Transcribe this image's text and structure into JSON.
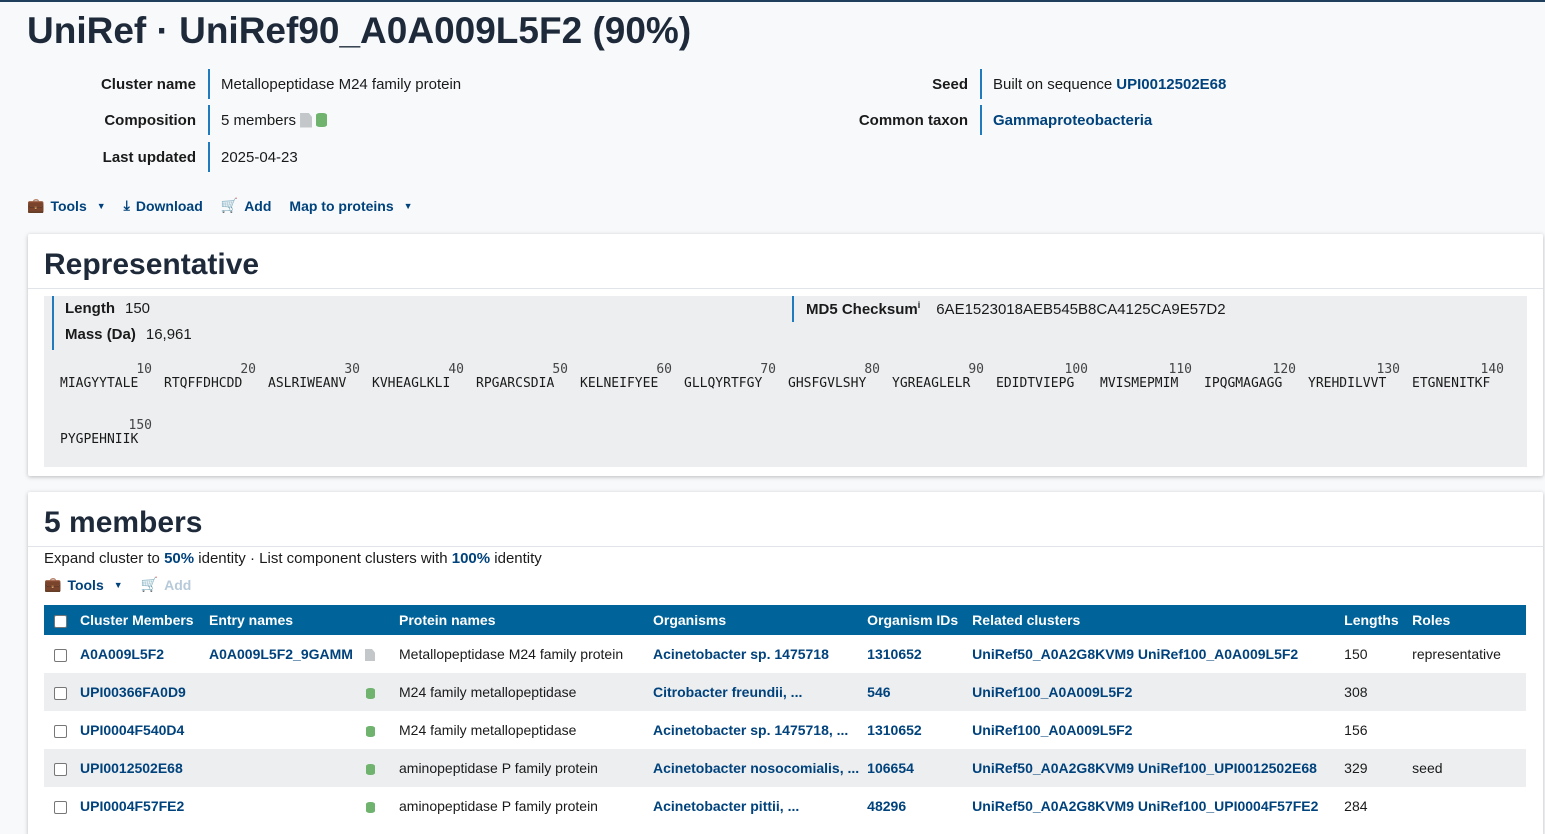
{
  "title": "UniRef · UniRef90_A0A009L5F2 (90%)",
  "info": {
    "cluster_name_label": "Cluster name",
    "cluster_name": "Metallopeptidase M24 family protein",
    "composition_label": "Composition",
    "composition": "5 members",
    "last_updated_label": "Last updated",
    "last_updated": "2025-04-23",
    "seed_label": "Seed",
    "seed_prefix": "Built on sequence",
    "seed_link": "UPI0012502E68",
    "common_taxon_label": "Common taxon",
    "common_taxon": "Gammaproteobacteria"
  },
  "toolbar": {
    "tools": "Tools",
    "download": "Download",
    "add": "Add",
    "map": "Map to proteins"
  },
  "representative": {
    "title": "Representative",
    "length_label": "Length",
    "length": "150",
    "mass_label": "Mass (Da)",
    "mass": "16,961",
    "md5_label": "MD5 Checksum",
    "md5_info": "i",
    "md5": "6AE1523018AEB545B8CA4125CA9E57D2",
    "chunks": [
      {
        "num": "10",
        "seq": "MIAGYYTALE"
      },
      {
        "num": "20",
        "seq": "RTQFFDHCDD"
      },
      {
        "num": "30",
        "seq": "ASLRIWEANV"
      },
      {
        "num": "40",
        "seq": "KVHEAGLKLI"
      },
      {
        "num": "50",
        "seq": "RPGARCSDIA"
      },
      {
        "num": "60",
        "seq": "KELNEIFYEE"
      },
      {
        "num": "70",
        "seq": "GLLQYRTFGY"
      },
      {
        "num": "80",
        "seq": "GHSFGVLSHY"
      },
      {
        "num": "90",
        "seq": "YGREAGLELR"
      },
      {
        "num": "100",
        "seq": "EDIDTVIEPG"
      },
      {
        "num": "110",
        "seq": "MVISMEPMIM"
      },
      {
        "num": "120",
        "seq": "IPQGMAGAGG"
      },
      {
        "num": "130",
        "seq": "YREHDILVVT"
      },
      {
        "num": "140",
        "seq": "ETGNENITKF"
      },
      {
        "num": "150",
        "seq": "PYGPEHNIIK"
      }
    ]
  },
  "members": {
    "title": "5 members",
    "expand_prefix": "Expand cluster to",
    "expand_link": "50%",
    "expand_middle": "identity · List component clusters with",
    "expand_link2": "100%",
    "expand_suffix": "identity",
    "tools": "Tools",
    "add": "Add",
    "columns": [
      "Cluster Members",
      "Entry names",
      "Protein names",
      "Organisms",
      "Organism IDs",
      "Related clusters",
      "Lengths",
      "Roles"
    ],
    "rows": [
      {
        "id": "A0A009L5F2",
        "entry": "A0A009L5F2_9GAMM",
        "icon": "doc",
        "protein": "Metallopeptidase M24 family protein",
        "organism": "Acinetobacter sp. 1475718",
        "orgid": "1310652",
        "related": "UniRef50_A0A2G8KVM9 UniRef100_A0A009L5F2",
        "length": "150",
        "role": "representative"
      },
      {
        "id": "UPI00366FA0D9",
        "entry": "",
        "icon": "db",
        "protein": "M24 family metallopeptidase",
        "organism": "Citrobacter freundii, ...",
        "orgid": "546",
        "related": "UniRef100_A0A009L5F2",
        "length": "308",
        "role": ""
      },
      {
        "id": "UPI0004F540D4",
        "entry": "",
        "icon": "db",
        "protein": "M24 family metallopeptidase",
        "organism": "Acinetobacter sp. 1475718, ...",
        "orgid": "1310652",
        "related": "UniRef100_A0A009L5F2",
        "length": "156",
        "role": ""
      },
      {
        "id": "UPI0012502E68",
        "entry": "",
        "icon": "db",
        "protein": "aminopeptidase P family protein",
        "organism": "Acinetobacter nosocomialis, ...",
        "orgid": "106654",
        "related": "UniRef50_A0A2G8KVM9 UniRef100_UPI0012502E68",
        "length": "329",
        "role": "seed"
      },
      {
        "id": "UPI0004F57FE2",
        "entry": "",
        "icon": "db",
        "protein": "aminopeptidase P family protein",
        "organism": "Acinetobacter pittii, ...",
        "orgid": "48296",
        "related": "UniRef50_A0A2G8KVM9 UniRef100_UPI0004F57FE2",
        "length": "284",
        "role": ""
      }
    ]
  }
}
